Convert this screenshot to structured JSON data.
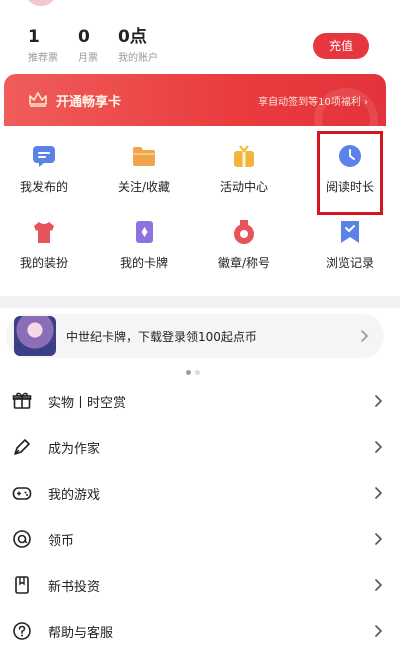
{
  "stats": [
    {
      "value": "1",
      "label": "推荐票"
    },
    {
      "value": "0",
      "label": "月票"
    },
    {
      "value": "0点",
      "label": "我的账户"
    }
  ],
  "recharge_label": "充值",
  "vip_banner": {
    "title": "开通畅享卡",
    "promo": "享自动签到等10项福利 ›"
  },
  "grid_items": [
    {
      "label": "我发布的",
      "icon": "message-icon"
    },
    {
      "label": "关注/收藏",
      "icon": "folder-icon"
    },
    {
      "label": "活动中心",
      "icon": "gift-box-icon"
    },
    {
      "label": "阅读时长",
      "icon": "clock-icon"
    },
    {
      "label": "我的装扮",
      "icon": "tshirt-icon"
    },
    {
      "label": "我的卡牌",
      "icon": "card-icon"
    },
    {
      "label": "徽章/称号",
      "icon": "medal-icon"
    },
    {
      "label": "浏览记录",
      "icon": "history-icon"
    }
  ],
  "promo": {
    "text": "中世纪卡牌，下载登录领100起点币"
  },
  "menu_items": [
    {
      "label": "实物丨时空赏",
      "icon": "gift-icon"
    },
    {
      "label": "成为作家",
      "icon": "pen-icon"
    },
    {
      "label": "我的游戏",
      "icon": "gamepad-icon"
    },
    {
      "label": "领币",
      "icon": "coin-icon"
    },
    {
      "label": "新书投资",
      "icon": "bookmark-icon"
    },
    {
      "label": "帮助与客服",
      "icon": "help-icon"
    }
  ],
  "colors": {
    "accent": "#e8363e",
    "highlight": "#d6141e",
    "icon_blue": "#5b82e6",
    "icon_orange": "#f0a54a",
    "icon_purple": "#8e72e0",
    "icon_red": "#e6545a"
  }
}
